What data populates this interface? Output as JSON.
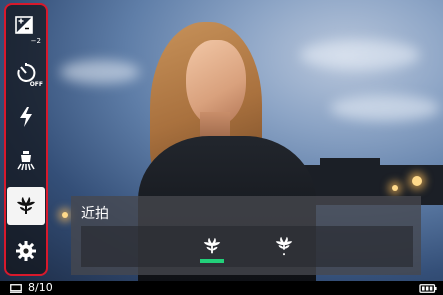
{
  "sidebar": {
    "items": [
      {
        "icon": "exposure-compensation-icon",
        "badge": "−2"
      },
      {
        "icon": "self-timer-off-icon",
        "badge": "OFF"
      },
      {
        "icon": "flash-icon"
      },
      {
        "icon": "lamp-icon"
      },
      {
        "icon": "macro-flower-icon",
        "selected": true
      },
      {
        "icon": "gear-icon"
      }
    ],
    "border_color": "#d8192c"
  },
  "macro_panel": {
    "title": "近拍",
    "options": [
      {
        "icon": "macro-on-icon",
        "selected": true
      },
      {
        "icon": "macro-off-icon",
        "selected": false
      }
    ],
    "selected_color": "#22d07a"
  },
  "status": {
    "counter": "8/10",
    "frame_icon": "frame-icon",
    "battery_icon": "battery-full-icon"
  }
}
